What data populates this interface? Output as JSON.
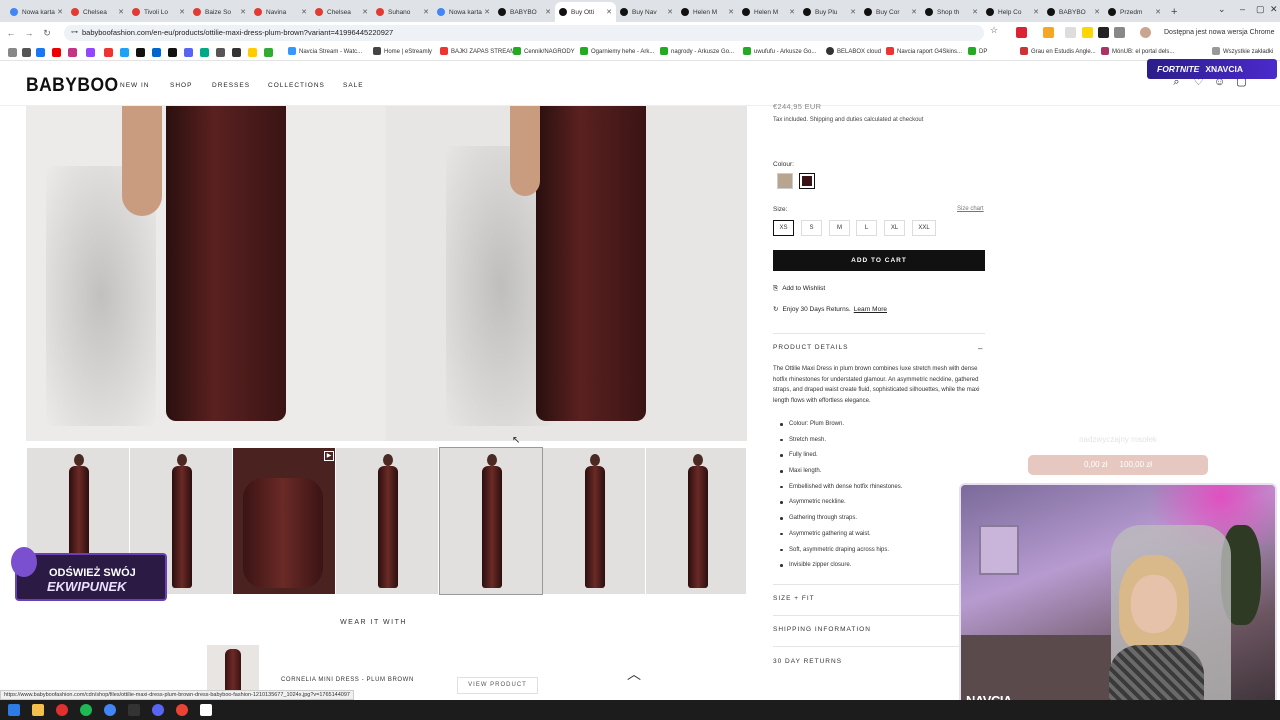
{
  "browser": {
    "tabs": [
      {
        "label": "Nowa karta",
        "color": "#4285f4"
      },
      {
        "label": "Chelsea",
        "color": "#e03c31"
      },
      {
        "label": "Tivoli Lo",
        "color": "#e03c31"
      },
      {
        "label": "Baize So",
        "color": "#e03c31"
      },
      {
        "label": "Navina",
        "color": "#e03c31"
      },
      {
        "label": "Chelsea",
        "color": "#e03c31"
      },
      {
        "label": "Suhano",
        "color": "#e03c31"
      },
      {
        "label": "Nowa karta",
        "color": "#4285f4"
      },
      {
        "label": "BABYBO",
        "color": "#111111"
      },
      {
        "label": "Buy Otti",
        "color": "#111111"
      },
      {
        "label": "Buy Nav",
        "color": "#111111"
      },
      {
        "label": "Helen M",
        "color": "#111111"
      },
      {
        "label": "Helen M",
        "color": "#111111"
      },
      {
        "label": "Buy Plu",
        "color": "#111111"
      },
      {
        "label": "Buy Cor",
        "color": "#111111"
      },
      {
        "label": "Shop th",
        "color": "#111111"
      },
      {
        "label": "Help Co",
        "color": "#111111"
      },
      {
        "label": "BABYBO",
        "color": "#111111"
      },
      {
        "label": "Przedm",
        "color": "#111111"
      }
    ],
    "active_tab_index": 9,
    "url": "babyboofashion.com/en-eu/products/ottilie-maxi-dress-plum-brown?variant=41996445220927",
    "update_notice": "Dostępna jest nowa wersja Chrome",
    "bookmarks": [
      "Navcia Stream - Watc...",
      "Home | eStreamly",
      "BAJKI ZAPAS STREAM",
      "Cennik/NAGRODY",
      "Ogarniemy hehe - Ark...",
      "nagrody - Arkusze Go...",
      "uwufufu - Arkusze Go...",
      "BELABOX cloud",
      "Navcia raport G4Skins...",
      "DP",
      "Grau en Estudis Angle...",
      "MónUB: el portal dels...",
      "Wszystkie zakładki"
    ]
  },
  "site": {
    "logo": "BABYBOO",
    "nav": [
      "NEW IN",
      "SHOP",
      "DRESSES",
      "COLLECTIONS",
      "SALE"
    ]
  },
  "product": {
    "price": "€244,95 EUR",
    "tax_note": "Tax included. Shipping and duties calculated at checkout",
    "colour_label": "Colour:",
    "size_label": "Size:",
    "size_chart": "Size chart",
    "sizes": [
      "XS",
      "S",
      "M",
      "L",
      "XL",
      "XXL"
    ],
    "selected_size": "XS",
    "swatch_colors": [
      "#b8a590",
      "#3a1418"
    ],
    "add_to_cart": "ADD TO CART",
    "wishlist": "Add to Wishlist",
    "returns_text": "Enjoy 30 Days Returns.",
    "learn_more": "Learn More",
    "details_heading": "PRODUCT DETAILS",
    "description": "The Ottilie Maxi Dress in plum brown combines luxe stretch mesh with dense hotfix rhinestones for understated glamour. An asymmetric neckline, gathered straps, and draped waist create fluid, sophisticated silhouettes, while the maxi length flows with effortless elegance.",
    "bullets": [
      "Colour: Plum Brown.",
      "Stretch mesh.",
      "Fully lined.",
      "Maxi length.",
      "Embellished with dense hotfix rhinestones.",
      "Asymmetric neckline.",
      "Gathering through straps.",
      "Asymmetric gathering at waist.",
      "Soft, asymmetric draping across hips.",
      "Invisible zipper closure."
    ],
    "accordions": [
      "SIZE + FIT",
      "SHIPPING INFORMATION",
      "30 DAY RETURNS"
    ]
  },
  "wear_with": {
    "heading": "WEAR IT WITH",
    "item_name": "CORNELIA MINI DRESS - PLUM BROWN",
    "view_button": "VIEW PRODUCT"
  },
  "overlays": {
    "fortnite_brand": "FORTNITE",
    "fortnite_user": "XNAVCIA",
    "ekwipunek_line1": "ODŚWIEŻ SWÓJ",
    "ekwipunek_line2": "EKWIPUNEK",
    "goal_title": "nadzwyczajny rosołek",
    "goal_current": "0,00 zł",
    "goal_target": "100,00 zł",
    "goal_progress": 0,
    "cam_tag": "NAVCIA"
  },
  "status_url": "https://www.babyboofashion.com/cdn/shop/files/ottilie-maxi-dress-plum-brown-dress-babyboo-fashion-1210135677_1024x.jpg?v=1765144097"
}
